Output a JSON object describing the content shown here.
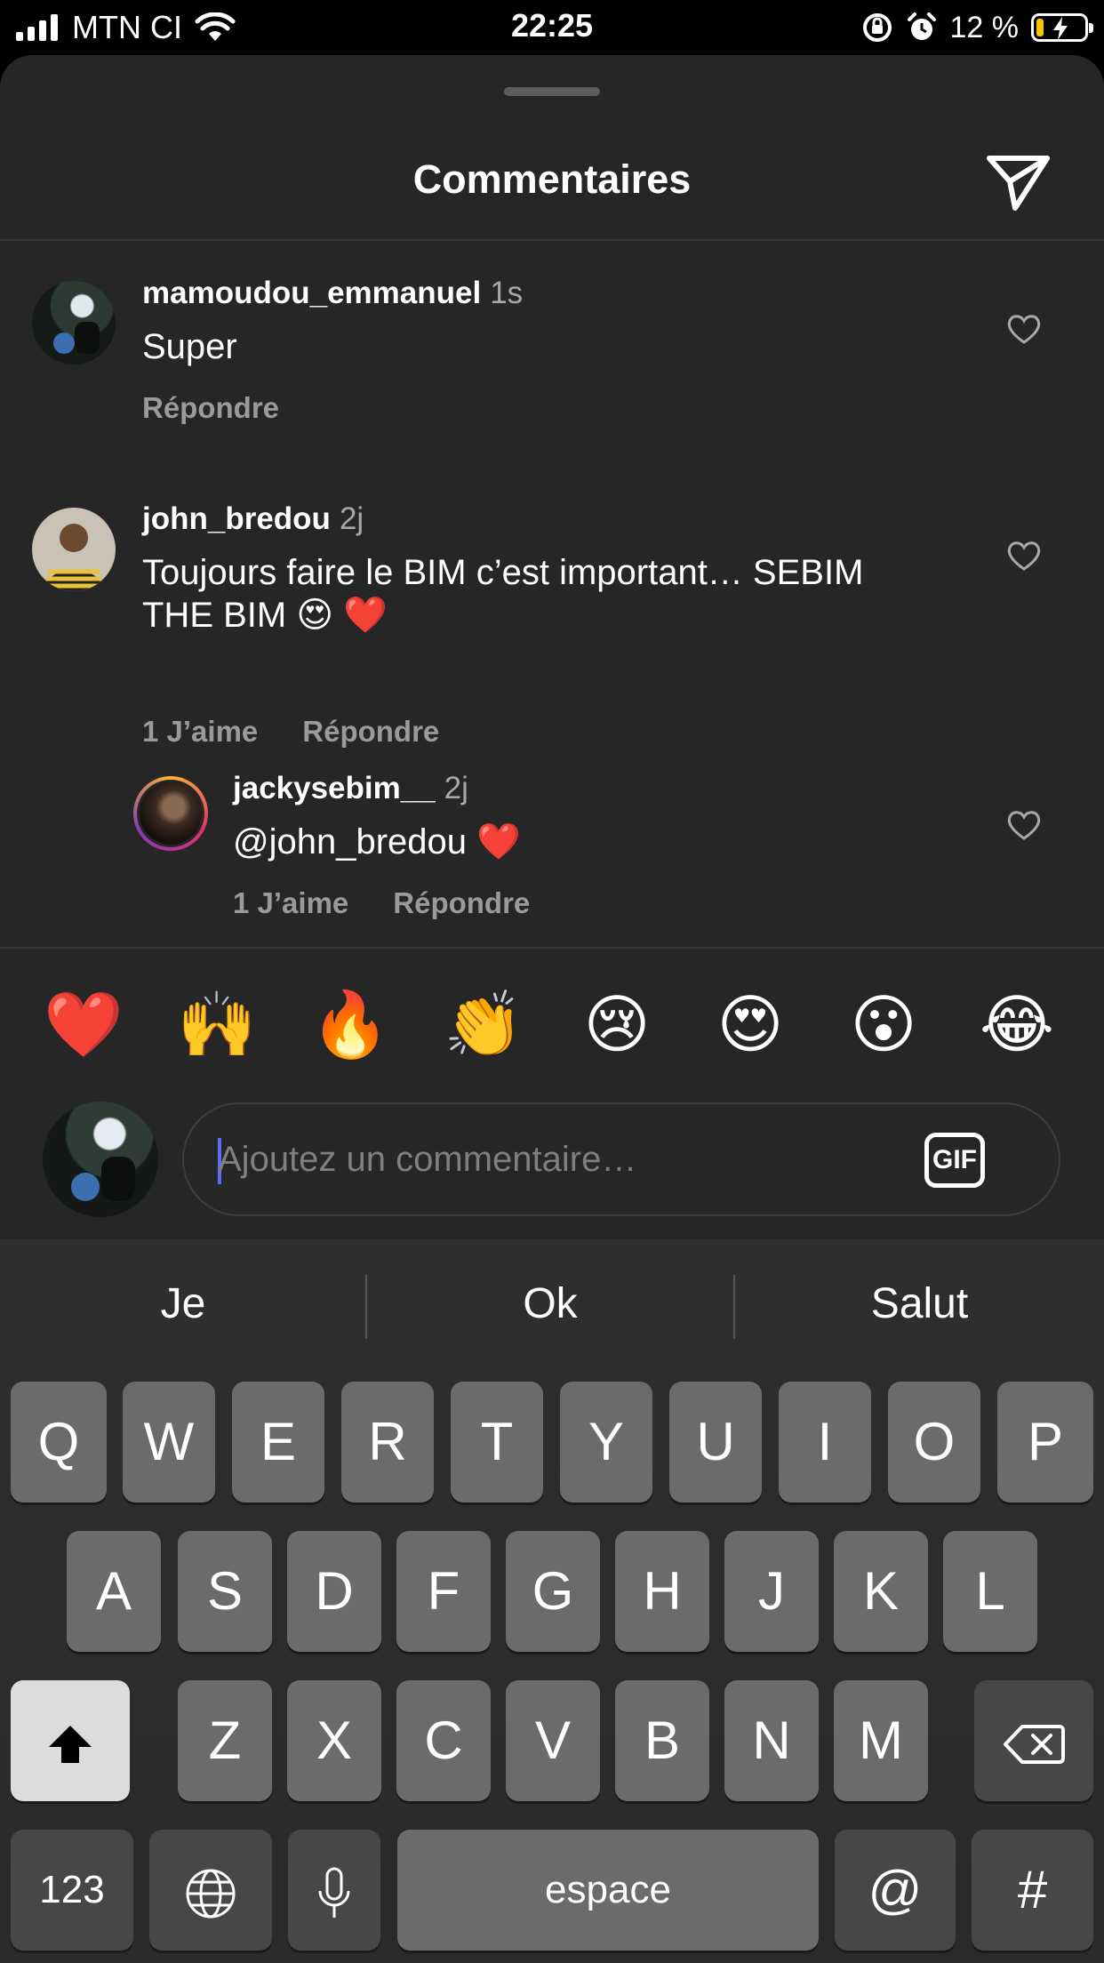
{
  "status_bar": {
    "carrier": "MTN CI",
    "time": "22:25",
    "battery_percent": "12 %",
    "battery_level": 0.12
  },
  "sheet": {
    "title": "Commentaires"
  },
  "comments": [
    {
      "username": "mamoudou_emmanuel",
      "time": "1s",
      "text": "Super",
      "likes": "",
      "reply": "Répondre"
    },
    {
      "username": "john_bredou",
      "time": "2j",
      "text_line1": "Toujours faire le BIM c’est important… SEBIM",
      "text_line2": "THE BIM 😍 ❤️",
      "likes": "1 J’aime",
      "reply": "Répondre"
    },
    {
      "username": "jackysebim__",
      "time": "2j",
      "text": "@john_bredou ❤️",
      "likes": "1 J’aime",
      "reply": "Répondre"
    }
  ],
  "quick_emojis": [
    "❤️",
    "🙌",
    "🔥",
    "👏",
    "😢",
    "😍",
    "😮",
    "😂"
  ],
  "composer": {
    "placeholder": "Ajoutez un commentaire…",
    "gif_label": "GIF"
  },
  "keyboard": {
    "suggestions": [
      "Je",
      "Ok",
      "Salut"
    ],
    "row1": [
      "Q",
      "W",
      "E",
      "R",
      "T",
      "Y",
      "U",
      "I",
      "O",
      "P"
    ],
    "row2": [
      "A",
      "S",
      "D",
      "F",
      "G",
      "H",
      "J",
      "K",
      "L"
    ],
    "row3": [
      "Z",
      "X",
      "C",
      "V",
      "B",
      "N",
      "M"
    ],
    "numbers_label": "123",
    "space_label": "espace",
    "at_label": "@",
    "hash_label": "#"
  }
}
